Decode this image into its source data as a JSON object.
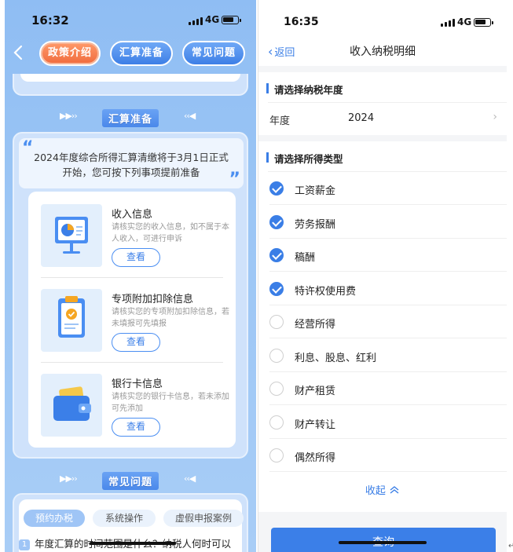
{
  "left": {
    "status": {
      "time": "16:32",
      "network": "4G"
    },
    "nav": {
      "back_icon": "chevron-left-icon",
      "tabs": [
        {
          "label": "政策介绍",
          "active": true
        },
        {
          "label": "汇算准备",
          "active": false
        },
        {
          "label": "常见问题",
          "active": false
        }
      ]
    },
    "prep": {
      "title": "汇算准备",
      "intro": "2024年度综合所得汇算清缴将于3月1日正式开始，您可按下列事项提前准备",
      "items": [
        {
          "name": "收入信息",
          "desc": "请核实您的收入信息，如不属于本人收入，可进行申诉",
          "button": "查看",
          "icon": "chart-board-icon"
        },
        {
          "name": "专项附加扣除信息",
          "desc": "请核实您的专项附加扣除信息，若未填报可先填报",
          "button": "查看",
          "icon": "clipboard-check-icon"
        },
        {
          "name": "银行卡信息",
          "desc": "请核实您的银行卡信息，若未添加可先添加",
          "button": "查看",
          "icon": "wallet-icon"
        }
      ]
    },
    "faq": {
      "title": "常见问题",
      "tabs": [
        "预约办税",
        "系统操作",
        "虚假申报案例"
      ],
      "first_question_num": "1",
      "first_question": "年度汇算的时间范围是什么？纳税人何时可以"
    },
    "colors": {
      "accent": "#3b7fe8",
      "active_tab": "#f06b3d",
      "background": "#9cc6f5"
    }
  },
  "right": {
    "status": {
      "time": "16:35",
      "network": "4G"
    },
    "nav": {
      "back_label": "返回",
      "title": "收入纳税明细"
    },
    "year_section": {
      "heading": "请选择纳税年度",
      "label": "年度",
      "value": "2024"
    },
    "type_section": {
      "heading": "请选择所得类型",
      "options": [
        {
          "label": "工资薪金",
          "checked": true
        },
        {
          "label": "劳务报酬",
          "checked": true
        },
        {
          "label": "稿酬",
          "checked": true
        },
        {
          "label": "特许权使用费",
          "checked": true
        },
        {
          "label": "经营所得",
          "checked": false
        },
        {
          "label": "利息、股息、红利",
          "checked": false
        },
        {
          "label": "财产租赁",
          "checked": false
        },
        {
          "label": "财产转让",
          "checked": false
        },
        {
          "label": "偶然所得",
          "checked": false
        }
      ],
      "collapse_label": "收起"
    },
    "query_button": "查询",
    "colors": {
      "accent": "#3a7ee6",
      "checked": "#3a7ee6"
    }
  }
}
